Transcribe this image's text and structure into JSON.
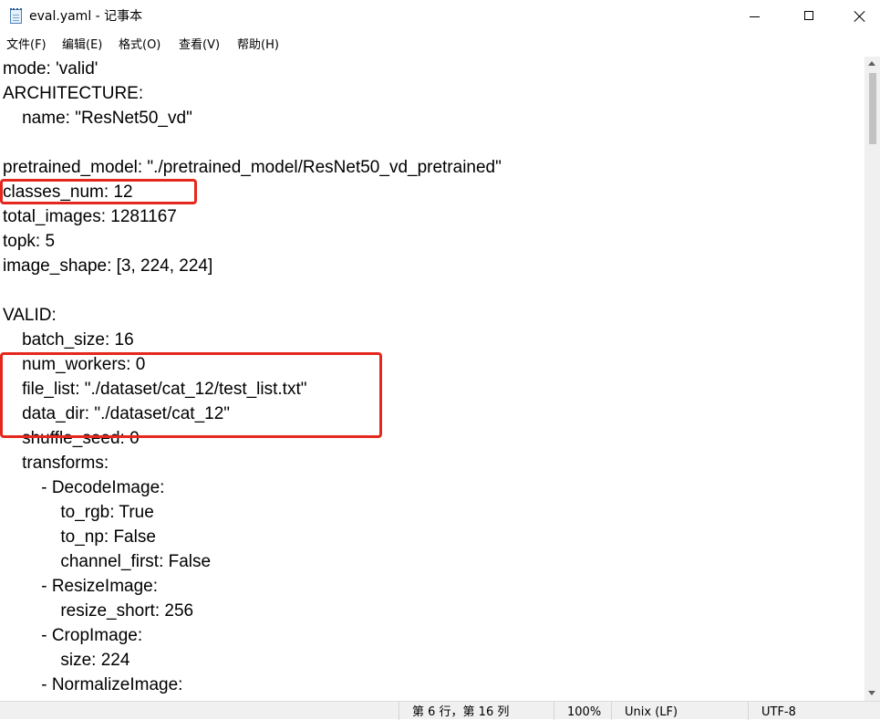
{
  "window": {
    "title": "eval.yaml - 记事本"
  },
  "menu": [
    {
      "label": "文件(F)"
    },
    {
      "label": "编辑(E)"
    },
    {
      "label": "格式(O)"
    },
    {
      "label": "查看(V)"
    },
    {
      "label": "帮助(H)"
    }
  ],
  "document": {
    "lines": [
      "mode: 'valid'",
      "ARCHITECTURE:",
      "    name: \"ResNet50_vd\"",
      "",
      "pretrained_model: \"./pretrained_model/ResNet50_vd_pretrained\"",
      "classes_num: 12",
      "total_images: 1281167",
      "topk: 5",
      "image_shape: [3, 224, 224]",
      "",
      "VALID:",
      "    batch_size: 16",
      "    num_workers: 0",
      "    file_list: \"./dataset/cat_12/test_list.txt\"",
      "    data_dir: \"./dataset/cat_12\"",
      "    shuffle_seed: 0",
      "    transforms:",
      "        - DecodeImage:",
      "            to_rgb: True",
      "            to_np: False",
      "            channel_first: False",
      "        - ResizeImage:",
      "            resize_short: 256",
      "        - CropImage:",
      "            size: 224",
      "        - NormalizeImage:"
    ]
  },
  "status": {
    "position": "第 6 行，第 16 列",
    "zoom": "100%",
    "line_ending": "Unix (LF)",
    "encoding": "UTF-8"
  },
  "colors": {
    "highlight": "#e5281e",
    "status_bg": "#f0f0f0"
  },
  "icons": {
    "app": "notepad-icon",
    "minimize": "minimize-icon",
    "maximize": "maximize-icon",
    "close": "close-icon"
  }
}
